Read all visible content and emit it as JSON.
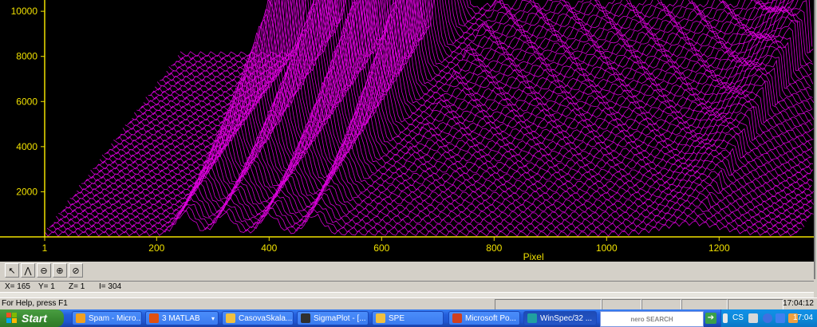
{
  "chart_data": {
    "type": "line",
    "title": "",
    "xlabel": "Pixel",
    "ylabel": "",
    "x_ticks": [
      1,
      200,
      400,
      600,
      800,
      1000,
      1200
    ],
    "y_ticks": [
      2000,
      4000,
      6000,
      8000,
      10000
    ],
    "xlim": [
      1,
      1340
    ],
    "ylim": [
      0,
      10500
    ],
    "series_color": "#e000e0",
    "background": "#000000",
    "axis_color": "#f0e000",
    "grid": false,
    "series_count": 60,
    "note_peaks": [
      {
        "x": 250,
        "front_y": 3200,
        "back_y": 9800
      },
      {
        "x": 320,
        "front_y": 3100,
        "back_y": 8500
      },
      {
        "x": 400,
        "front_y": 3000,
        "back_y": 9900
      },
      {
        "x": 480,
        "front_y": 2900,
        "back_y": 10000
      }
    ]
  },
  "toolbar": {
    "icons": [
      "cursor-icon",
      "peak-icon",
      "zoom-out-icon",
      "zoom-in-icon",
      "zoom-reset-icon"
    ]
  },
  "coords": {
    "x": "X= 165",
    "y": "Y= 1",
    "z": "Z= 1",
    "i": "I= 304"
  },
  "status": {
    "help": "For Help, press F1",
    "time": "17:04:12"
  },
  "taskbar": {
    "start": "Start",
    "tasks": [
      {
        "label": "Spam - Micro...",
        "color": "#f0a020"
      },
      {
        "label": "3 MATLAB",
        "color": "#e05010"
      },
      {
        "label": "CasovaSkala...",
        "color": "#f0c040"
      },
      {
        "label": "SigmaPlot - [...",
        "color": "#303030"
      },
      {
        "label": "SPE",
        "color": "#f0c040"
      },
      {
        "label": "Microsoft Po...",
        "color": "#d04020"
      },
      {
        "label": "WinSpec/32 ...",
        "color": "#20a0a0"
      }
    ],
    "nero": "nero SEARCH",
    "lang": "CS",
    "clock": "17:04"
  }
}
